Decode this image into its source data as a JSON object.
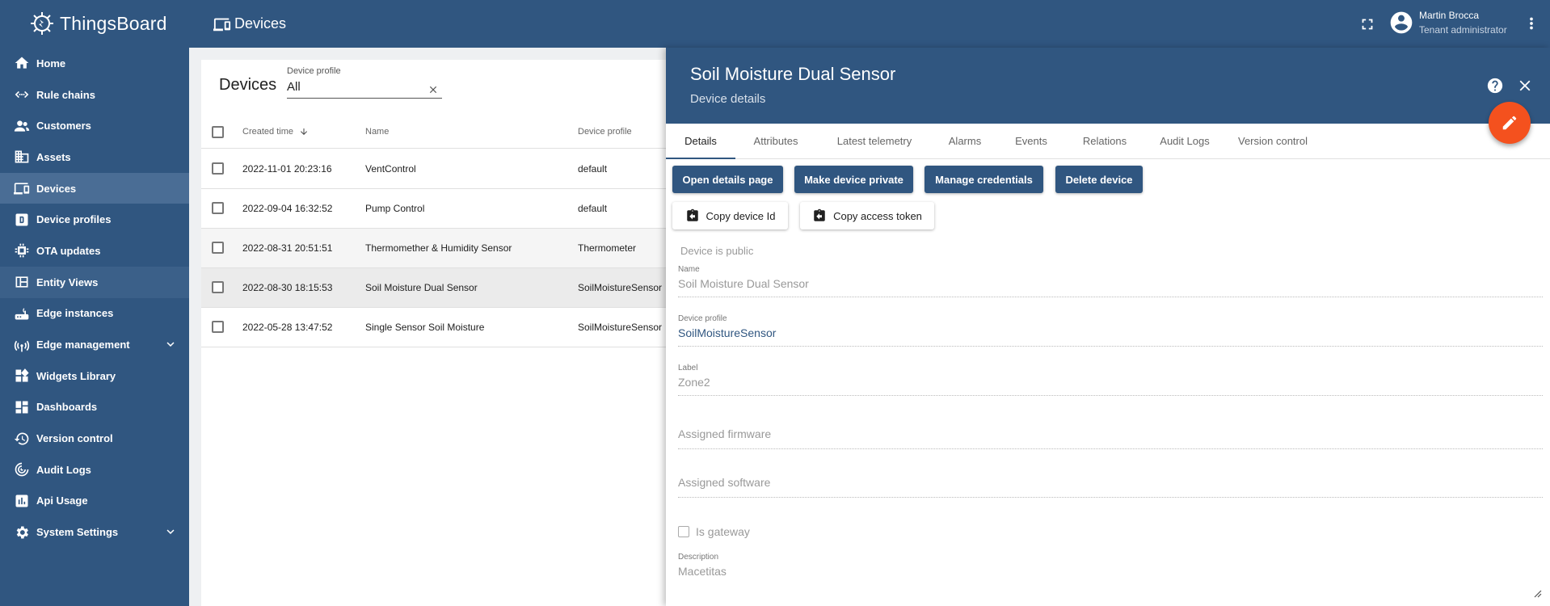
{
  "app": {
    "brand": "ThingsBoard",
    "page_title": "Devices"
  },
  "user": {
    "name": "Martin Brocca",
    "role": "Tenant administrator"
  },
  "sidebar": {
    "items": [
      {
        "label": "Home",
        "icon": "home-icon"
      },
      {
        "label": "Rule chains",
        "icon": "rule-chains-icon"
      },
      {
        "label": "Customers",
        "icon": "customers-icon"
      },
      {
        "label": "Assets",
        "icon": "assets-icon"
      },
      {
        "label": "Devices",
        "icon": "devices-icon",
        "active": true
      },
      {
        "label": "Device profiles",
        "icon": "device-profiles-icon"
      },
      {
        "label": "OTA updates",
        "icon": "ota-icon"
      },
      {
        "label": "Entity Views",
        "icon": "entity-views-icon"
      },
      {
        "label": "Edge instances",
        "icon": "router-icon"
      },
      {
        "label": "Edge management",
        "icon": "antenna-icon",
        "expandable": true
      },
      {
        "label": "Widgets Library",
        "icon": "widgets-icon"
      },
      {
        "label": "Dashboards",
        "icon": "dashboards-icon"
      },
      {
        "label": "Version control",
        "icon": "history-icon"
      },
      {
        "label": "Audit Logs",
        "icon": "audit-icon"
      },
      {
        "label": "Api Usage",
        "icon": "chart-icon"
      },
      {
        "label": "System Settings",
        "icon": "settings-icon",
        "expandable": true
      }
    ]
  },
  "devices_table": {
    "title": "Devices",
    "filter": {
      "label": "Device profile",
      "value": "All"
    },
    "columns": {
      "created": "Created time",
      "name": "Name",
      "profile": "Device profile"
    },
    "rows": [
      {
        "created": "2022-11-01 20:23:16",
        "name": "VentControl",
        "profile": "default"
      },
      {
        "created": "2022-09-04 16:32:52",
        "name": "Pump Control",
        "profile": "default"
      },
      {
        "created": "2022-08-31 20:51:51",
        "name": "Thermomether & Humidity Sensor",
        "profile": "Thermometer"
      },
      {
        "created": "2022-08-30 18:15:53",
        "name": "Soil Moisture Dual Sensor",
        "profile": "SoilMoistureSensor",
        "selected": true
      },
      {
        "created": "2022-05-28 13:47:52",
        "name": "Single Sensor Soil Moisture",
        "profile": "SoilMoistureSensor"
      }
    ]
  },
  "detail": {
    "title": "Soil Moisture Dual Sensor",
    "subtitle": "Device details",
    "tabs": [
      "Details",
      "Attributes",
      "Latest telemetry",
      "Alarms",
      "Events",
      "Relations",
      "Audit Logs",
      "Version control"
    ],
    "buttons": {
      "open": "Open details page",
      "private": "Make device private",
      "credentials": "Manage credentials",
      "delete": "Delete device",
      "copy_id": "Copy device Id",
      "copy_token": "Copy access token"
    },
    "public_text": "Device is public",
    "fields": {
      "name_label": "Name",
      "name_value": "Soil Moisture Dual Sensor",
      "profile_label": "Device profile",
      "profile_value": "SoilMoistureSensor",
      "label_label": "Label",
      "label_value": "Zone2",
      "firmware_placeholder": "Assigned firmware",
      "software_placeholder": "Assigned software",
      "gateway_label": "Is gateway",
      "description_label": "Description",
      "description_value": "Macetitas"
    }
  },
  "colors": {
    "primary": "#305680",
    "accent": "#f4511e"
  }
}
